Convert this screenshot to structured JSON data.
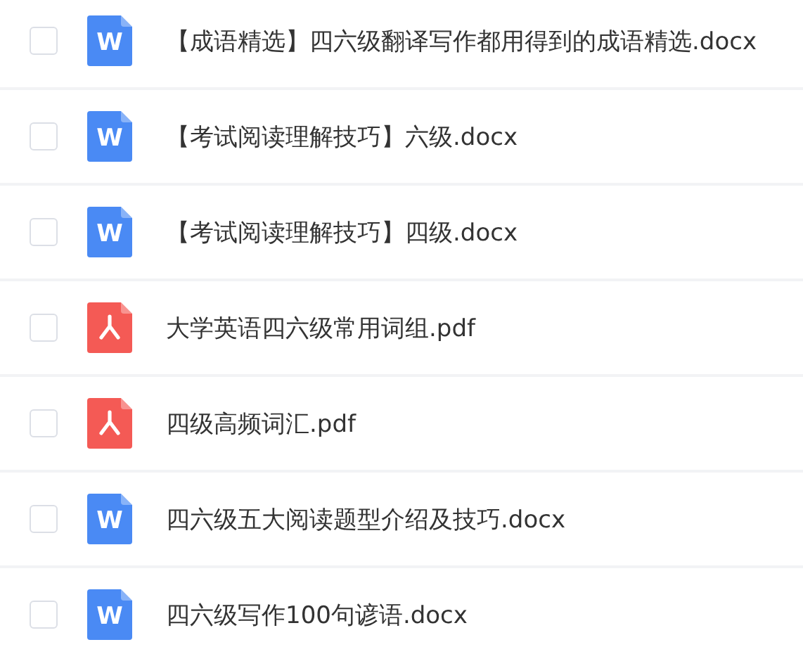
{
  "files": [
    {
      "name": "【成语精选】四六级翻译写作都用得到的成语精选.docx",
      "kind": "word",
      "icon_letter": "W",
      "checked": false
    },
    {
      "name": "【考试阅读理解技巧】六级.docx",
      "kind": "word",
      "icon_letter": "W",
      "checked": false
    },
    {
      "name": "【考试阅读理解技巧】四级.docx",
      "kind": "word",
      "icon_letter": "W",
      "checked": false
    },
    {
      "name": "大学英语四六级常用词组.pdf",
      "kind": "pdf",
      "checked": false
    },
    {
      "name": "四级高频词汇.pdf",
      "kind": "pdf",
      "checked": false
    },
    {
      "name": "四六级五大阅读题型介绍及技巧.docx",
      "kind": "word",
      "icon_letter": "W",
      "checked": false
    },
    {
      "name": "四六级写作100句谚语.docx",
      "kind": "word",
      "icon_letter": "W",
      "checked": false
    }
  ]
}
